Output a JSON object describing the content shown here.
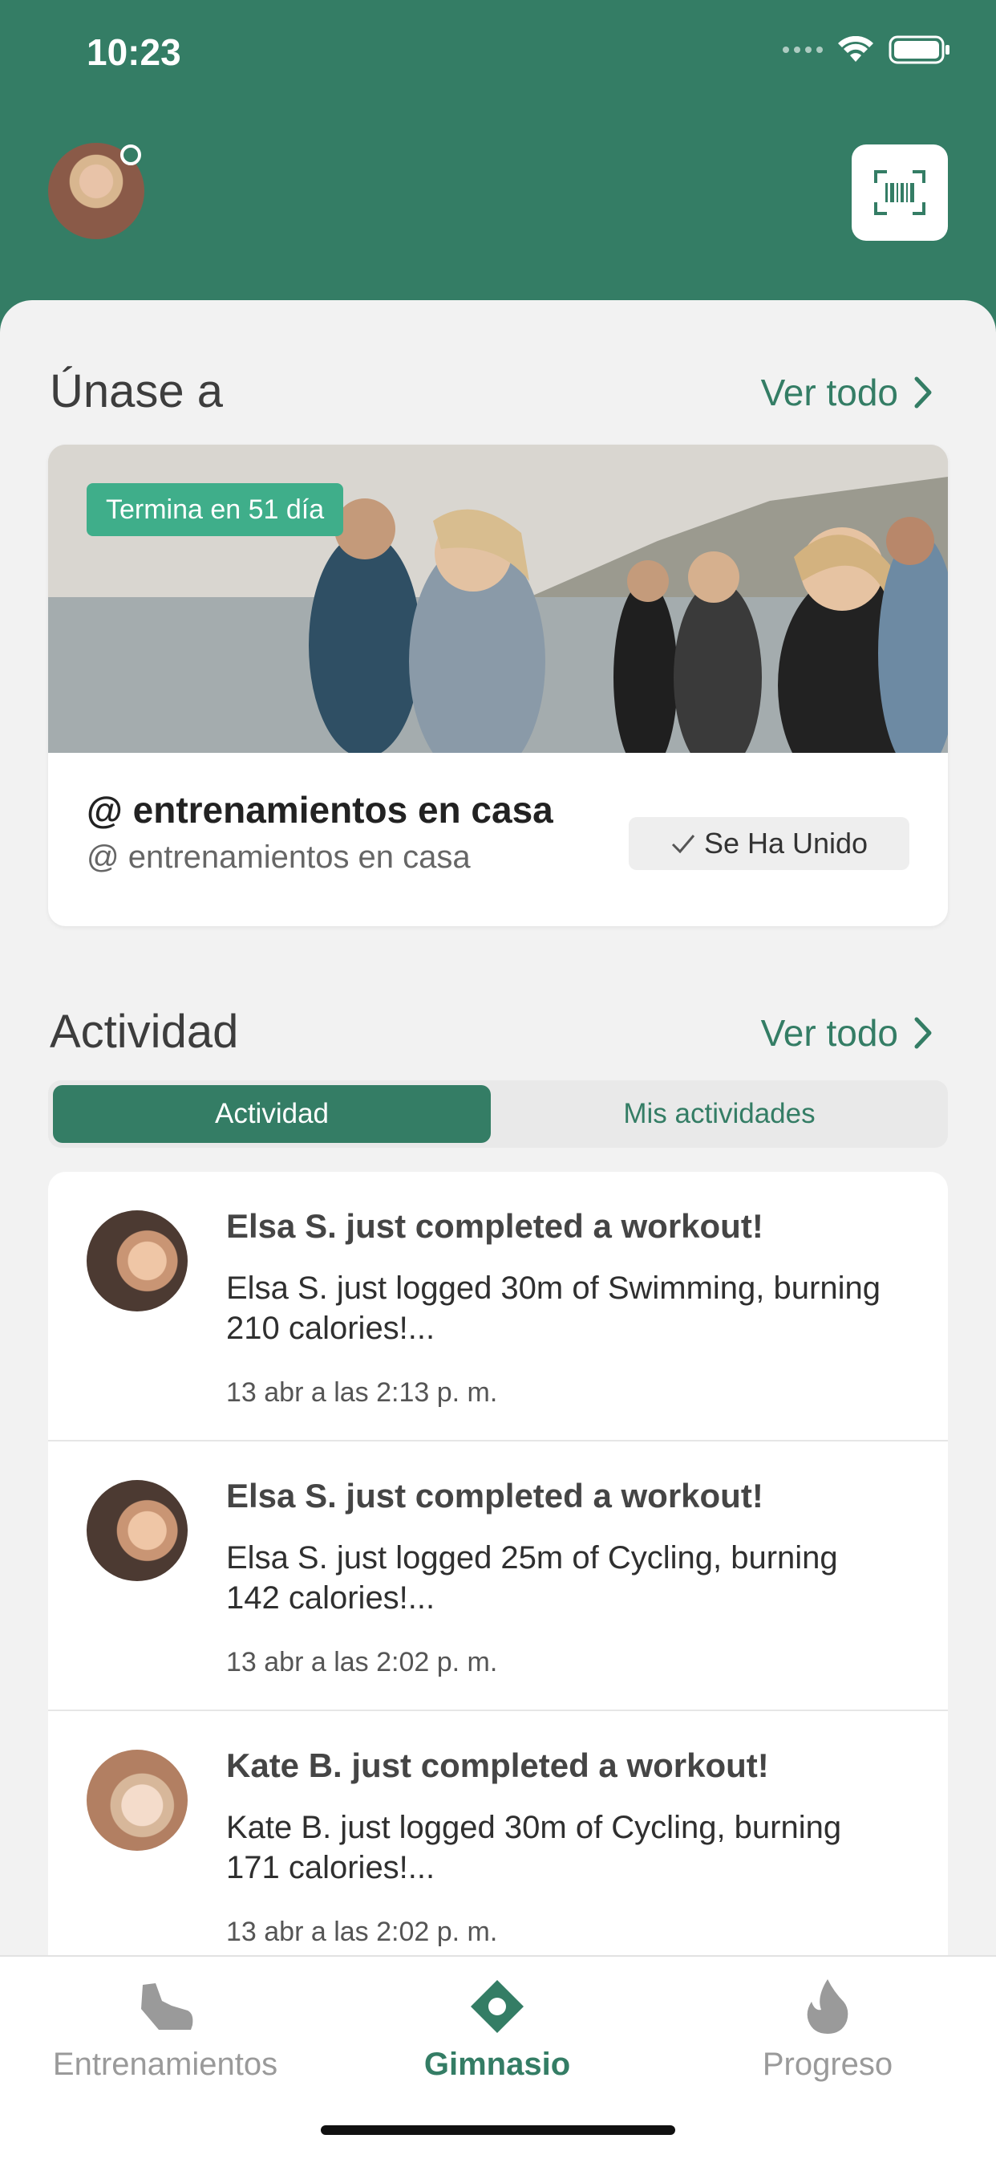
{
  "status": {
    "time": "10:23"
  },
  "join_section": {
    "title": "Únase a",
    "see_all": "Ver todo",
    "challenge": {
      "badge": "Termina en 51 día",
      "title": "@ entrenamientos en casa",
      "subtitle": "@ entrenamientos en casa",
      "joined_label": "Se Ha Unido"
    }
  },
  "activity_section": {
    "title": "Actividad",
    "see_all": "Ver todo",
    "tabs": [
      "Actividad",
      "Mis actividades"
    ],
    "items": [
      {
        "title": "Elsa S. just completed a workout!",
        "body": "Elsa S. just logged 30m of Swimming, burning 210 calories!...",
        "time": "13 abr a las 2:13 p. m."
      },
      {
        "title": "Elsa S. just completed a workout!",
        "body": "Elsa S. just logged 25m of Cycling, burning 142 calories!...",
        "time": "13 abr a las 2:02 p. m."
      },
      {
        "title": "Kate B. just completed a workout!",
        "body": "Kate B. just logged 30m of Cycling, burning 171 calories!...",
        "time": "13 abr a las 2:02 p. m."
      }
    ]
  },
  "tabbar": {
    "items": [
      {
        "label": "Entrenamientos",
        "icon": "shoe-icon"
      },
      {
        "label": "Gimnasio",
        "icon": "location-pin-icon"
      },
      {
        "label": "Progreso",
        "icon": "flame-icon"
      }
    ],
    "active_index": 1
  },
  "colors": {
    "brand": "#347d65",
    "badge": "#3fae8a"
  }
}
